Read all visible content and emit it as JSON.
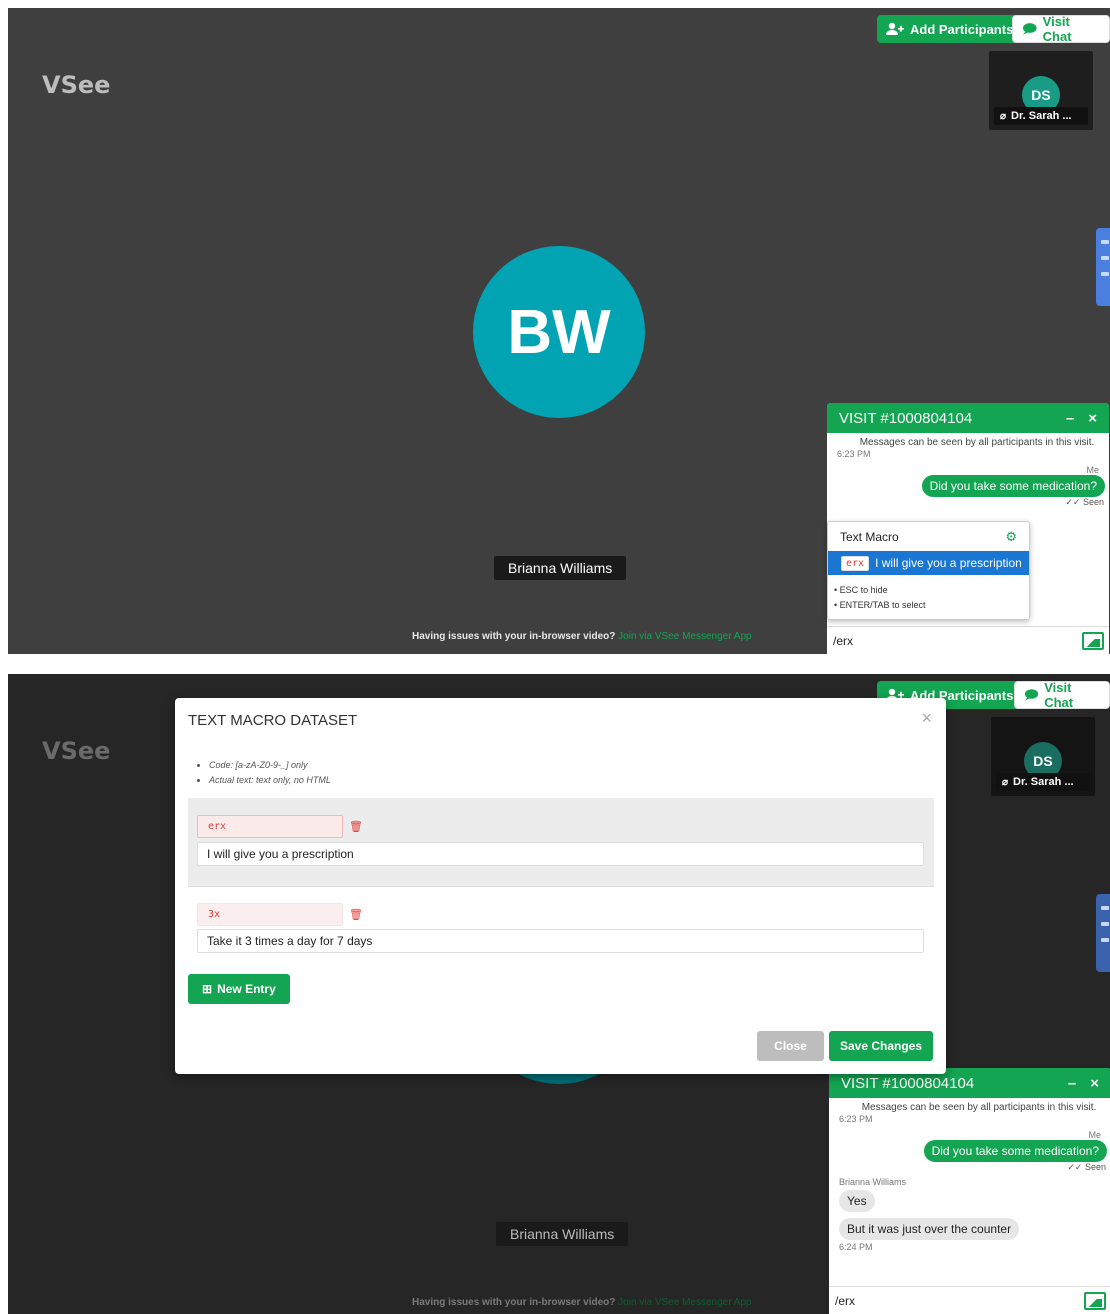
{
  "app": {
    "logo": "VSee"
  },
  "header": {
    "add_participants_label": "Add Participants",
    "visit_chat_label": "Visit Chat"
  },
  "participant_thumb": {
    "initials": "DS",
    "name": "Dr. Sarah ..."
  },
  "main_video": {
    "initials": "BW",
    "name": "Brianna Williams"
  },
  "footer": {
    "issue_text": "Having issues with your in-browser video?",
    "issue_link": "Join via VSee Messenger App"
  },
  "chat": {
    "title": "VISIT #1000804104",
    "minimize": "–",
    "close": "×",
    "notice": "Messages can be seen by all participants in this visit.",
    "time1": "6:23 PM",
    "me_label": "Me",
    "msg_me": "Did you take some medication?",
    "seen": "Seen",
    "sender_name": "Brianna Williams",
    "msg_them1": "Yes",
    "msg_them2": "But it was just over the counter",
    "time2": "6:24 PM",
    "input_value": "/erx"
  },
  "text_macro_popup": {
    "title": "Text Macro",
    "selected_code": "erx",
    "selected_text": "I will give you a prescription",
    "hint_esc": "ESC to hide",
    "hint_enter": "ENTER/TAB to select"
  },
  "modal": {
    "title": "TEXT MACRO DATASET",
    "close_x": "×",
    "hint_code": "Code: [a-zA-Z0-9-_] only",
    "hint_text": "Actual text: text only, no HTML",
    "entries": [
      {
        "code": "erx",
        "text": "I will give you a prescription"
      },
      {
        "code": "3x",
        "text": "Take it 3 times a day for 7 days"
      }
    ],
    "new_entry_label": "New Entry",
    "close_label": "Close",
    "save_label": "Save Changes"
  },
  "colors": {
    "brand_green": "#13a552",
    "avatar_teal": "#02a3b2",
    "selection_blue": "#1976d2",
    "code_red": "#e53935"
  },
  "icons": [
    "add-user-icon",
    "chat-icon",
    "mic-off-icon",
    "gear-icon",
    "image-icon",
    "trash-icon",
    "plus-box-icon",
    "double-check-icon"
  ]
}
